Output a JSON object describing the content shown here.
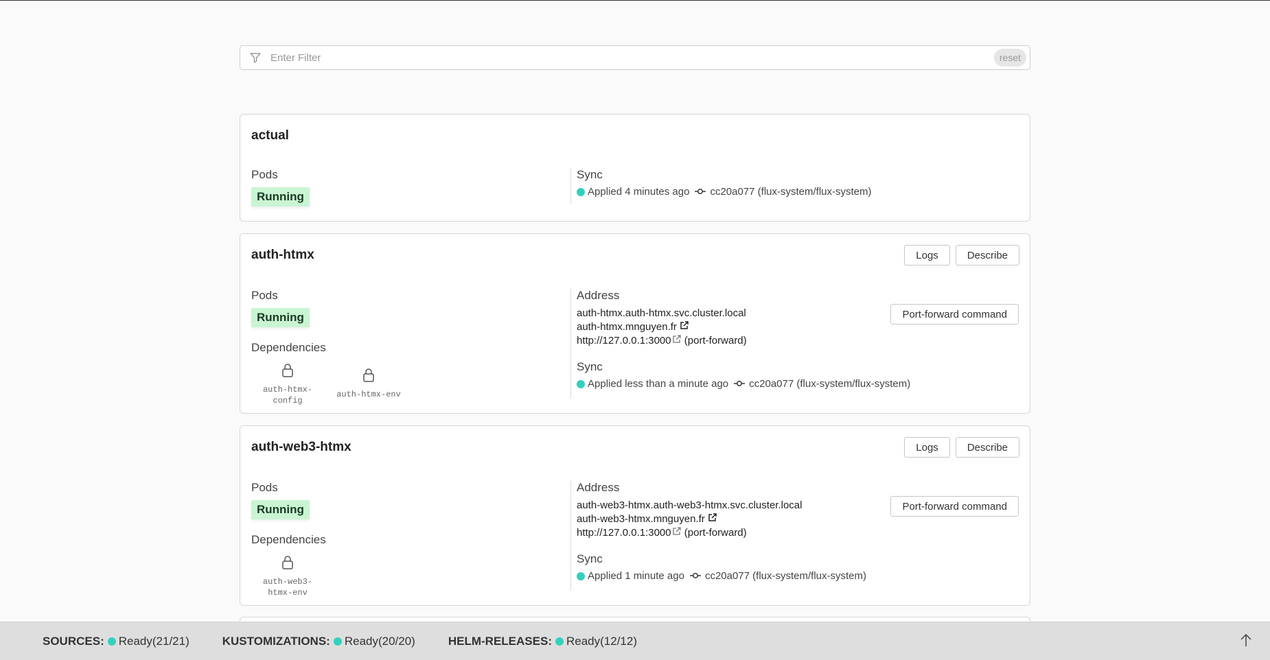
{
  "filter": {
    "placeholder": "Enter Filter",
    "reset_label": "reset"
  },
  "labels": {
    "pods": "Pods",
    "sync": "Sync",
    "address": "Address",
    "dependencies": "Dependencies",
    "logs": "Logs",
    "describe": "Describe",
    "port_forward": "Port-forward command",
    "running": "Running",
    "port_forward_suffix": "(port-forward)"
  },
  "cards": [
    {
      "name": "actual",
      "pods_status": "Running",
      "sync_text": "Applied 4 minutes ago",
      "commit": "cc20a077 (flux-system/flux-system)"
    },
    {
      "name": "auth-htmx",
      "pods_status": "Running",
      "dependencies": [
        "auth-htmx-config",
        "auth-htmx-env"
      ],
      "address": {
        "internal": "auth-htmx.auth-htmx.svc.cluster.local",
        "external": "auth-htmx.mnguyen.fr",
        "local": "http://127.0.0.1:3000"
      },
      "sync_text": "Applied less than a minute ago",
      "commit": "cc20a077 (flux-system/flux-system)"
    },
    {
      "name": "auth-web3-htmx",
      "pods_status": "Running",
      "dependencies": [
        "auth-web3-htmx-env"
      ],
      "address": {
        "internal": "auth-web3-htmx.auth-web3-htmx.svc.cluster.local",
        "external": "auth-web3-htmx.mnguyen.fr",
        "local": "http://127.0.0.1:3000"
      },
      "sync_text": "Applied 1 minute ago",
      "commit": "cc20a077 (flux-system/flux-system)"
    }
  ],
  "footer": {
    "sources": {
      "label": "SOURCES:",
      "status": "Ready(21/21)"
    },
    "kustomizations": {
      "label": "KUSTOMIZATIONS:",
      "status": "Ready(20/20)"
    },
    "helm_releases": {
      "label": "HELM-RELEASES:",
      "status": "Ready(12/12)"
    }
  },
  "colors": {
    "ready": "#35d0bd",
    "running_bg": "#c9f5d3"
  },
  "icons": [
    "filter-icon",
    "lock-icon",
    "commit-icon",
    "external-link-icon",
    "arrow-up-icon"
  ]
}
